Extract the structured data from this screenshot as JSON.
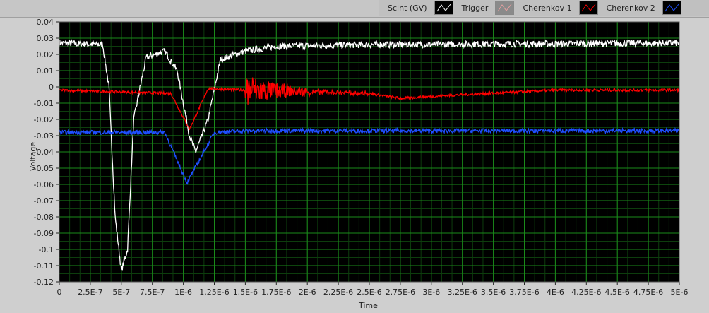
{
  "legend": [
    {
      "label": "Scint (GV)",
      "color": "#ffffff"
    },
    {
      "label": "Trigger",
      "color": "#e8a0a0"
    },
    {
      "label": "Cherenkov 1",
      "color": "#ff0000"
    },
    {
      "label": "Cherenkov 2",
      "color": "#1e4fff"
    }
  ],
  "chart_data": {
    "type": "line",
    "xlabel": "Time",
    "ylabel": "Voltage",
    "xlim": [
      0,
      5e-06
    ],
    "ylim": [
      -0.12,
      0.04
    ],
    "grid": true,
    "legend_placement": "top-right",
    "xticks": [
      "0",
      "2.5E-7",
      "5E-7",
      "7.5E-7",
      "1E-6",
      "1.25E-6",
      "1.5E-6",
      "1.75E-6",
      "2E-6",
      "2.25E-6",
      "2.5E-6",
      "2.75E-6",
      "3E-6",
      "3.25E-6",
      "3.5E-6",
      "3.75E-6",
      "4E-6",
      "4.25E-6",
      "4.5E-6",
      "4.75E-6",
      "5E-6"
    ],
    "yticks": [
      "0.04",
      "0.03",
      "0.02",
      "0.01",
      "0",
      "-0.01",
      "-0.02",
      "-0.03",
      "-0.04",
      "-0.05",
      "-0.06",
      "-0.07",
      "-0.08",
      "-0.09",
      "-0.1",
      "-0.11",
      "-0.12"
    ],
    "series": [
      {
        "name": "Scint (GV)",
        "color": "#ffffff",
        "noise": 0.002,
        "x": [
          0,
          3.5e-07,
          4e-07,
          4.5e-07,
          5e-07,
          5.5e-07,
          6e-07,
          7e-07,
          8.5e-07,
          9.5e-07,
          1.05e-06,
          1.1e-06,
          1.2e-06,
          1.3e-06,
          1.5e-06,
          1.75e-06,
          2.5e-06,
          5e-06
        ],
        "y": [
          0.027,
          0.026,
          0.0,
          -0.08,
          -0.113,
          -0.1,
          -0.02,
          0.018,
          0.022,
          0.01,
          -0.03,
          -0.04,
          -0.02,
          0.017,
          0.022,
          0.025,
          0.026,
          0.027
        ]
      },
      {
        "name": "Cherenkov 1",
        "color": "#ff0000",
        "noise": 0.0008,
        "x": [
          0,
          9e-07,
          1.05e-06,
          1.2e-06,
          1.5e-06,
          2.5e-06,
          2.75e-06,
          3.2e-06,
          4e-06,
          5e-06
        ],
        "y": [
          -0.002,
          -0.004,
          -0.026,
          -0.001,
          -0.002,
          -0.004,
          -0.007,
          -0.005,
          -0.002,
          -0.002
        ],
        "burst": {
          "start": 1.5e-06,
          "end": 2.5e-06,
          "amp": 0.011
        }
      },
      {
        "name": "Cherenkov 2",
        "color": "#1e4fff",
        "noise": 0.0013,
        "x": [
          0,
          8.5e-07,
          1.03e-06,
          1.25e-06,
          1.5e-06,
          5e-06
        ],
        "y": [
          -0.028,
          -0.028,
          -0.059,
          -0.028,
          -0.027,
          -0.027
        ]
      }
    ]
  }
}
